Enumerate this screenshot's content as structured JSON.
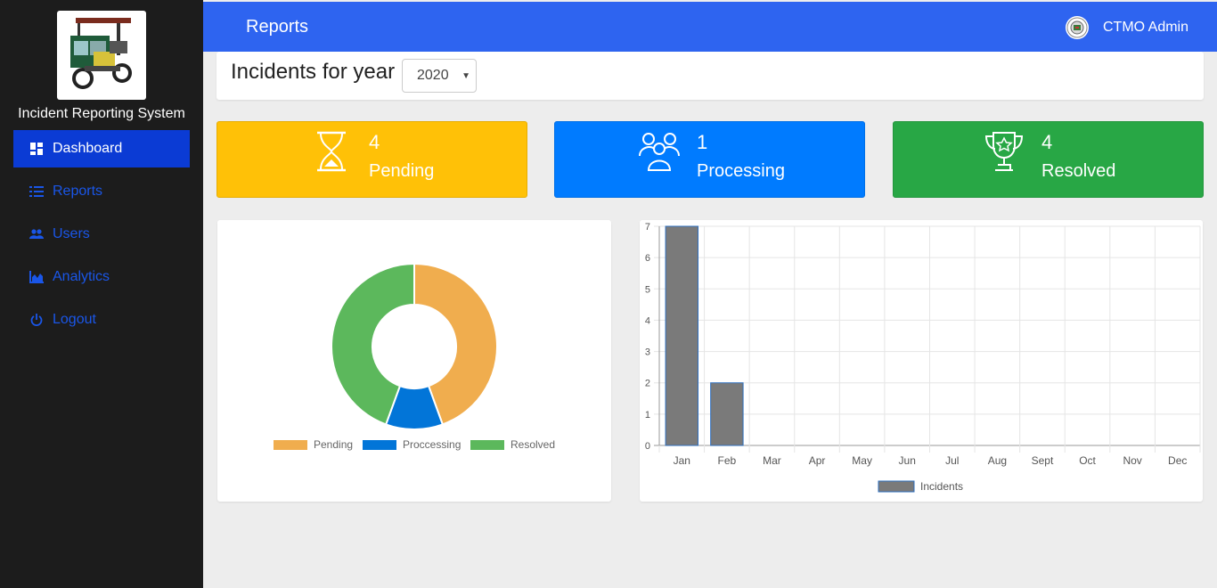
{
  "app": {
    "name": "Incident Reporting System",
    "logo_icon": "tricycle-logo"
  },
  "sidebar": {
    "items": [
      {
        "label": "Dashboard",
        "icon": "dashboard-icon",
        "active": true
      },
      {
        "label": "Reports",
        "icon": "list-icon"
      },
      {
        "label": "Users",
        "icon": "users-icon"
      },
      {
        "label": "Analytics",
        "icon": "area-chart-icon"
      },
      {
        "label": "Logout",
        "icon": "power-icon"
      }
    ]
  },
  "topbar": {
    "title": "Reports",
    "user_name": "CTMO Admin",
    "user_icon": "seal-avatar-icon"
  },
  "filter": {
    "label": "Incidents for year",
    "year": "2020"
  },
  "stats": [
    {
      "count": "4",
      "label": "Pending",
      "icon": "hourglass-icon",
      "color": "#ffc107"
    },
    {
      "count": "1",
      "label": "Processing",
      "icon": "users-group-icon",
      "color": "#007bff"
    },
    {
      "count": "4",
      "label": "Resolved",
      "icon": "trophy-icon",
      "color": "#28a745"
    }
  ],
  "colors": {
    "sidebar_bg": "#1c1c1c",
    "topbar_bg": "#2e64f0",
    "active_nav": "#0b3bd4",
    "nav_link": "#1a56e8"
  },
  "chart_data": [
    {
      "type": "pie",
      "donut": true,
      "categories": [
        "Pending",
        "Proccessing",
        "Resolved"
      ],
      "values": [
        4,
        1,
        4
      ],
      "colors": [
        "#f0ad4e",
        "#0275d8",
        "#5cb85c"
      ],
      "legend": "bottom"
    },
    {
      "type": "bar",
      "categories": [
        "Jan",
        "Feb",
        "Mar",
        "Apr",
        "May",
        "Jun",
        "Jul",
        "Aug",
        "Sept",
        "Oct",
        "Nov",
        "Dec"
      ],
      "series": [
        {
          "name": "Incidents",
          "values": [
            7,
            2,
            0,
            0,
            0,
            0,
            0,
            0,
            0,
            0,
            0,
            0
          ]
        }
      ],
      "ylim": [
        0,
        7
      ],
      "yticks": [
        "0",
        "1",
        "2",
        "3",
        "4",
        "5",
        "6",
        "7"
      ],
      "grid": true,
      "bar_color": "#7a7a7a",
      "bar_border": "#2e6fbf",
      "legend": "bottom"
    }
  ]
}
